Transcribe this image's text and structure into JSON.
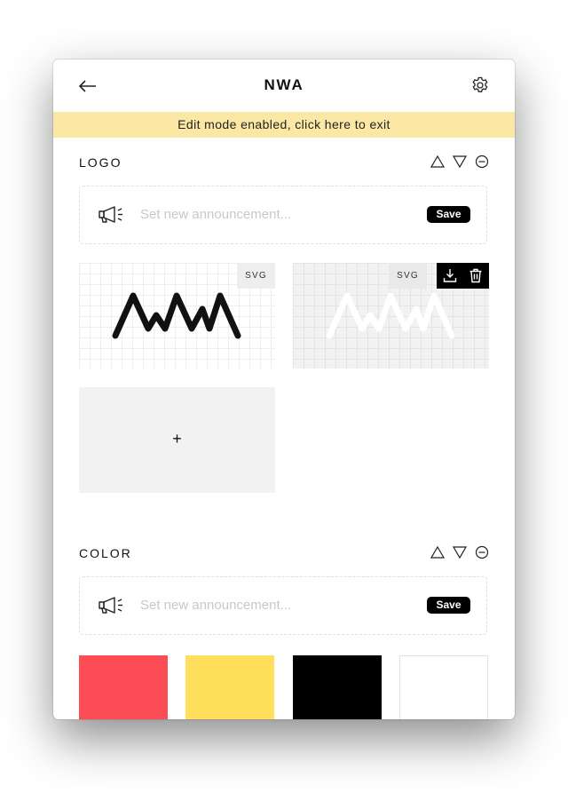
{
  "header": {
    "title": "NWA"
  },
  "banner": {
    "text": "Edit mode enabled, click here to exit"
  },
  "sections": {
    "logo": {
      "title": "LOGO",
      "announcement": {
        "placeholder": "Set new announcement...",
        "save_label": "Save"
      },
      "assets": [
        {
          "format": "SVG",
          "variant": "black"
        },
        {
          "format": "SVG",
          "variant": "white"
        }
      ],
      "add_label": "+"
    },
    "color": {
      "title": "COLOR",
      "announcement": {
        "placeholder": "Set new announcement...",
        "save_label": "Save"
      },
      "swatches": [
        "#fc4c55",
        "#ffdf5c",
        "#000000",
        "#ffffff"
      ]
    }
  },
  "icons": {
    "back": "arrow-left-icon",
    "settings": "gear-icon",
    "move_up": "triangle-up-icon",
    "move_down": "triangle-down-icon",
    "remove": "minus-circle-icon",
    "announcement": "megaphone-icon",
    "download": "download-icon",
    "delete": "trash-icon"
  },
  "colors": {
    "banner_bg": "#fbe8a4",
    "accent": "#000000"
  }
}
